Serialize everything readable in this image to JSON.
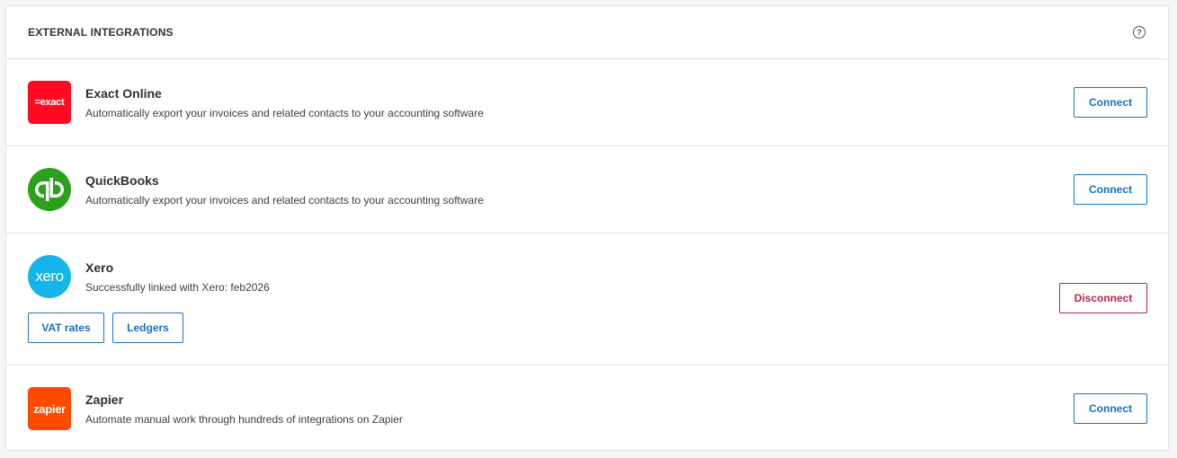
{
  "header": {
    "title": "EXTERNAL INTEGRATIONS",
    "help_glyph": "?"
  },
  "integrations": [
    {
      "name": "Exact Online",
      "description": "Automatically export your invoices and related contacts to your accounting software",
      "logo_text": "=exact",
      "logo_color": "#ff0a22",
      "button_label": "Connect"
    },
    {
      "name": "QuickBooks",
      "description": "Automatically export your invoices and related contacts to your accounting software",
      "logo_text": "qb",
      "logo_color": "#2ca01c",
      "button_label": "Connect"
    },
    {
      "name": "Xero",
      "description": "Successfully linked with Xero: feb2026",
      "logo_text": "xero",
      "logo_color": "#13b5ea",
      "button_label": "Disconnect",
      "sub_buttons": [
        "VAT rates",
        "Ledgers"
      ]
    },
    {
      "name": "Zapier",
      "description": "Automate manual work through hundreds of integrations on Zapier",
      "logo_text": "zapier",
      "logo_color": "#ff4a00",
      "button_label": "Connect"
    }
  ],
  "colors": {
    "accent": "#1a6fc4",
    "danger": "#b8264a",
    "border": "#dfe3e7"
  }
}
